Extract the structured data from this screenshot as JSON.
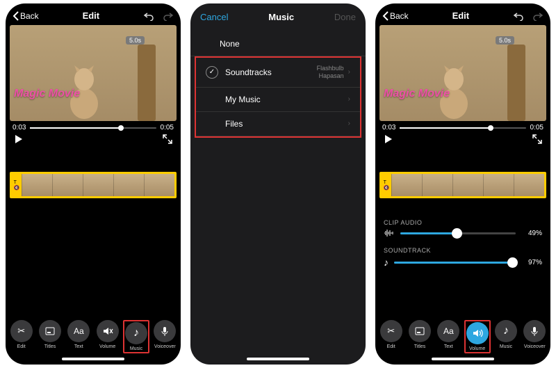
{
  "phone1": {
    "back": "Back",
    "title": "Edit",
    "badge": "5.0s",
    "magic": "Magic Movie",
    "time_start": "0:03",
    "time_end": "0:05",
    "progress_pct": 72,
    "tools": [
      {
        "label": "Edit",
        "icon": "scissors"
      },
      {
        "label": "Titles",
        "icon": "titles"
      },
      {
        "label": "Text",
        "icon": "Aa"
      },
      {
        "label": "Volume",
        "icon": "mute"
      },
      {
        "label": "Music",
        "icon": "note"
      },
      {
        "label": "Voiceover",
        "icon": "mic"
      }
    ],
    "highlight_index": 4
  },
  "phone2": {
    "cancel": "Cancel",
    "title": "Music",
    "done": "Done",
    "none": "None",
    "rows": [
      {
        "label": "Soundtracks",
        "sub1": "Flashbulb",
        "sub2": "Hapasan",
        "checked": true
      },
      {
        "label": "My Music"
      },
      {
        "label": "Files"
      }
    ]
  },
  "phone3": {
    "back": "Back",
    "title": "Edit",
    "badge": "5.0s",
    "magic": "Magic Movie",
    "time_start": "0:03",
    "time_end": "0:05",
    "progress_pct": 72,
    "clip_label": "CLIP AUDIO",
    "clip_pct": 49,
    "sound_label": "SOUNDTRACK",
    "sound_pct": 97,
    "tools": [
      {
        "label": "Edit",
        "icon": "scissors"
      },
      {
        "label": "Titles",
        "icon": "titles"
      },
      {
        "label": "Text",
        "icon": "Aa"
      },
      {
        "label": "Volume",
        "icon": "speaker"
      },
      {
        "label": "Music",
        "icon": "note"
      },
      {
        "label": "Voiceover",
        "icon": "mic"
      }
    ],
    "highlight_index": 3
  },
  "icons": {
    "scissors": "✂",
    "titles": "⎕",
    "Aa": "Aa",
    "mute": "🔇",
    "speaker": "🔊",
    "note": "♪",
    "mic": "🎤"
  }
}
